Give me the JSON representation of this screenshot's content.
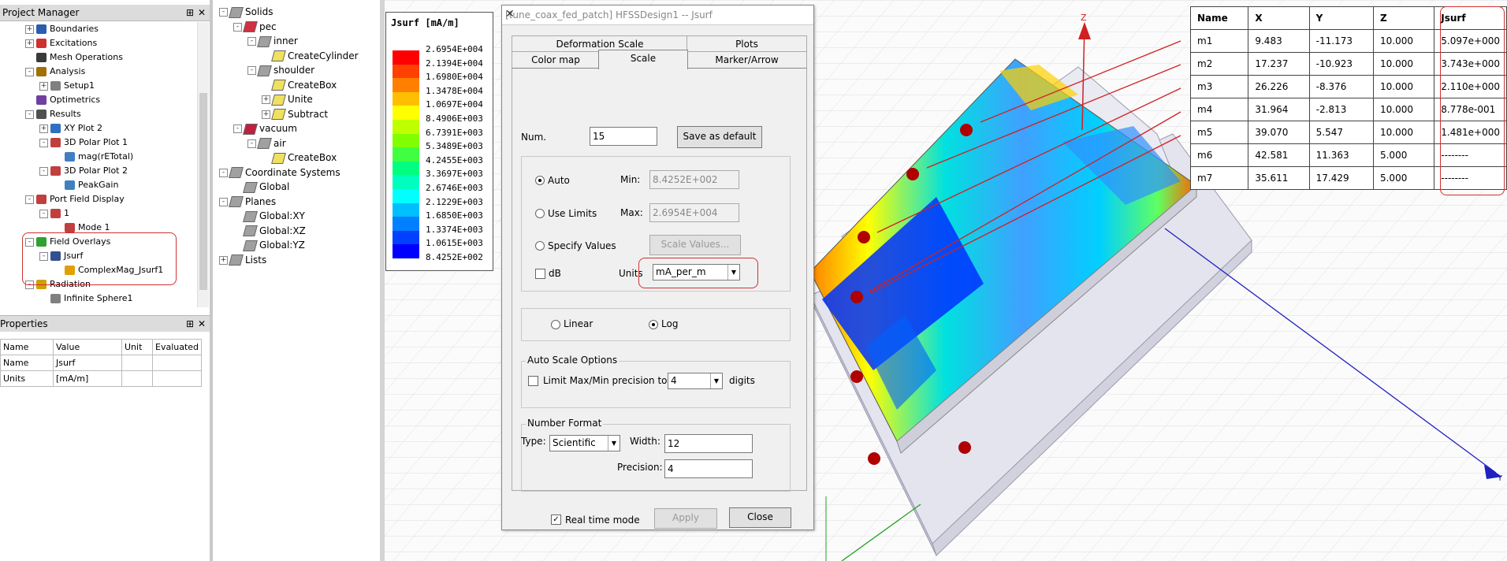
{
  "project_manager": {
    "title": "Project Manager",
    "tree": [
      {
        "label": "Boundaries",
        "indent": 1,
        "exp": "+",
        "icon": "boundaries-icon"
      },
      {
        "label": "Excitations",
        "indent": 1,
        "exp": "+",
        "icon": "excitations-icon"
      },
      {
        "label": "Mesh Operations",
        "indent": 1,
        "exp": "",
        "icon": "mesh-icon"
      },
      {
        "label": "Analysis",
        "indent": 1,
        "exp": "-",
        "icon": "analysis-icon"
      },
      {
        "label": "Setup1",
        "indent": 2,
        "exp": "+",
        "icon": "setup-icon"
      },
      {
        "label": "Optimetrics",
        "indent": 1,
        "exp": "",
        "icon": "optimetrics-icon"
      },
      {
        "label": "Results",
        "indent": 1,
        "exp": "-",
        "icon": "results-icon"
      },
      {
        "label": "XY Plot 2",
        "indent": 2,
        "exp": "+",
        "icon": "xy-plot-icon"
      },
      {
        "label": "3D Polar Plot 1",
        "indent": 2,
        "exp": "-",
        "icon": "polar-plot-icon"
      },
      {
        "label": "mag(rETotal)",
        "indent": 3,
        "exp": "",
        "icon": "trace-icon"
      },
      {
        "label": "3D Polar Plot 2",
        "indent": 2,
        "exp": "-",
        "icon": "polar-plot-icon"
      },
      {
        "label": "PeakGain",
        "indent": 3,
        "exp": "",
        "icon": "trace-icon"
      },
      {
        "label": "Port Field Display",
        "indent": 1,
        "exp": "-",
        "icon": "port-icon"
      },
      {
        "label": "1",
        "indent": 2,
        "exp": "-",
        "icon": "port-icon"
      },
      {
        "label": "Mode 1",
        "indent": 3,
        "exp": "",
        "icon": "port-icon"
      },
      {
        "label": "Field Overlays",
        "indent": 1,
        "exp": "-",
        "icon": "field-overlays-icon"
      },
      {
        "label": "Jsurf",
        "indent": 2,
        "exp": "-",
        "icon": "jsurf-icon"
      },
      {
        "label": "ComplexMag_Jsurf1",
        "indent": 3,
        "exp": "",
        "icon": "complexmag-icon"
      },
      {
        "label": "Radiation",
        "indent": 1,
        "exp": "-",
        "icon": "radiation-icon"
      },
      {
        "label": "Infinite Sphere1",
        "indent": 2,
        "exp": "",
        "icon": "sphere-icon"
      }
    ]
  },
  "properties": {
    "title": "Properties",
    "headers": [
      "Name",
      "Value",
      "Unit",
      "Evaluated"
    ],
    "rows": [
      [
        "Name",
        "Jsurf",
        "",
        ""
      ],
      [
        "Units",
        "[mA/m]",
        "",
        ""
      ]
    ]
  },
  "model_tree": [
    {
      "label": "Solids",
      "indent": 0,
      "exp": "-",
      "icon": "solids-icon"
    },
    {
      "label": "pec",
      "indent": 1,
      "exp": "-",
      "icon": "material-pec-icon"
    },
    {
      "label": "inner",
      "indent": 2,
      "exp": "-",
      "icon": "object-icon"
    },
    {
      "label": "CreateCylinder",
      "indent": 3,
      "exp": "",
      "icon": "cylinder-icon"
    },
    {
      "label": "shoulder",
      "indent": 2,
      "exp": "-",
      "icon": "object-icon"
    },
    {
      "label": "CreateBox",
      "indent": 3,
      "exp": "",
      "icon": "box-icon"
    },
    {
      "label": "Unite",
      "indent": 3,
      "exp": "+",
      "icon": "unite-icon"
    },
    {
      "label": "Subtract",
      "indent": 3,
      "exp": "+",
      "icon": "subtract-icon"
    },
    {
      "label": "vacuum",
      "indent": 1,
      "exp": "-",
      "icon": "material-vacuum-icon"
    },
    {
      "label": "air",
      "indent": 2,
      "exp": "-",
      "icon": "object-icon"
    },
    {
      "label": "CreateBox",
      "indent": 3,
      "exp": "",
      "icon": "box-icon"
    },
    {
      "label": "Coordinate Systems",
      "indent": 0,
      "exp": "-",
      "icon": "coord-icon"
    },
    {
      "label": "Global",
      "indent": 1,
      "exp": "",
      "icon": "globe-icon"
    },
    {
      "label": "Planes",
      "indent": 0,
      "exp": "-",
      "icon": "planes-icon"
    },
    {
      "label": "Global:XY",
      "indent": 1,
      "exp": "",
      "icon": "plane-icon"
    },
    {
      "label": "Global:XZ",
      "indent": 1,
      "exp": "",
      "icon": "plane-icon"
    },
    {
      "label": "Global:YZ",
      "indent": 1,
      "exp": "",
      "icon": "plane-icon"
    },
    {
      "label": "Lists",
      "indent": 0,
      "exp": "+",
      "icon": "lists-icon"
    }
  ],
  "legend": {
    "title": "Jsurf [mA/m]",
    "values": [
      "2.6954E+004",
      "2.1394E+004",
      "1.6980E+004",
      "1.3478E+004",
      "1.0697E+004",
      "8.4906E+003",
      "6.7391E+003",
      "5.3489E+003",
      "4.2455E+003",
      "3.3697E+003",
      "2.6746E+003",
      "2.1229E+003",
      "1.6850E+003",
      "1.3374E+003",
      "1.0615E+003",
      "8.4252E+002"
    ],
    "colors": [
      "#ff0000",
      "#ff4000",
      "#ff8000",
      "#ffbf00",
      "#ffff00",
      "#bfff00",
      "#80ff00",
      "#40ff40",
      "#00ff80",
      "#00ffbf",
      "#00ffff",
      "#00bfff",
      "#0080ff",
      "#0040ff",
      "#0000ff"
    ]
  },
  "dialog": {
    "title": "[tune_coax_fed_patch] HFSSDesign1 -- Jsurf",
    "tabs_back": [
      "Deformation Scale",
      "Plots"
    ],
    "tabs_front": [
      "Color map",
      "Scale",
      "Marker/Arrow"
    ],
    "num_label": "Num.",
    "num_value": "15",
    "save_default": "Save as default",
    "auto": "Auto",
    "use_limits": "Use Limits",
    "specify_values": "Specify Values",
    "min_label": "Min:",
    "min_value": "8.4252E+002",
    "max_label": "Max:",
    "max_value": "2.6954E+004",
    "scale_values": "Scale Values...",
    "db": "dB",
    "units_label": "Units",
    "units_value": "mA_per_m",
    "linear": "Linear",
    "log": "Log",
    "auto_scale_title": "Auto Scale Options",
    "limit_label": "Limit Max/Min precision to",
    "limit_value": "4",
    "digits": "digits",
    "number_format_title": "Number Format",
    "type_label": "Type:",
    "type_value": "Scientific",
    "width_label": "Width:",
    "width_value": "12",
    "precision_label": "Precision:",
    "precision_value": "4",
    "realtime": "Real time mode",
    "apply": "Apply",
    "close": "Close"
  },
  "markers_table": {
    "headers": [
      "Name",
      "X",
      "Y",
      "Z",
      "Jsurf"
    ],
    "rows": [
      [
        "m1",
        "9.483",
        "-11.173",
        "10.000",
        "5.097e+000"
      ],
      [
        "m2",
        "17.237",
        "-10.923",
        "10.000",
        "3.743e+000"
      ],
      [
        "m3",
        "26.226",
        "-8.376",
        "10.000",
        "2.110e+000"
      ],
      [
        "m4",
        "31.964",
        "-2.813",
        "10.000",
        "8.778e-001"
      ],
      [
        "m5",
        "39.070",
        "5.547",
        "10.000",
        "1.481e+000"
      ],
      [
        "m6",
        "42.581",
        "11.363",
        "5.000",
        "--------"
      ],
      [
        "m7",
        "35.611",
        "17.429",
        "5.000",
        "--------"
      ]
    ]
  },
  "axes": {
    "z": "Z",
    "y": "Y"
  }
}
